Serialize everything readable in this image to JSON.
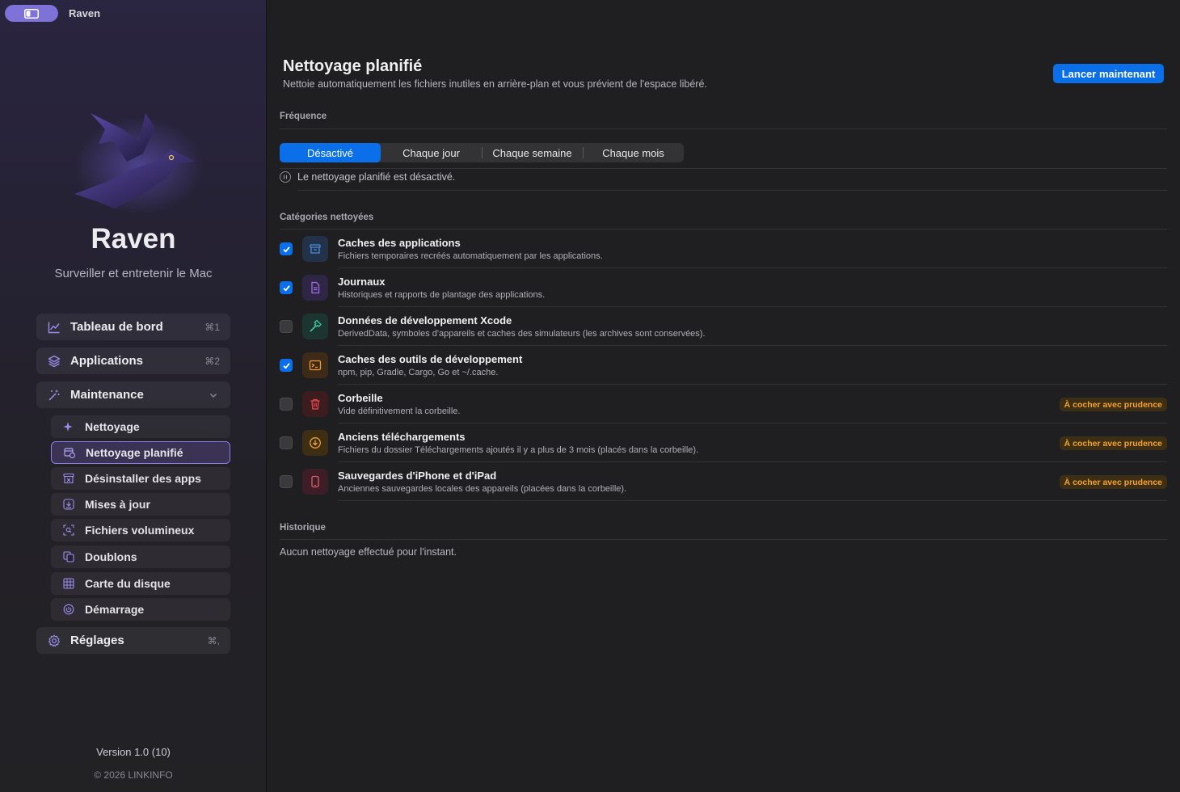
{
  "window": {
    "title": "Raven"
  },
  "brand": {
    "name": "Raven",
    "tagline": "Surveiller et entretenir le Mac"
  },
  "nav": {
    "dashboard": {
      "label": "Tableau de bord",
      "shortcut": "⌘1",
      "icon": "chart-line-icon"
    },
    "applications": {
      "label": "Applications",
      "shortcut": "⌘2",
      "icon": "layers-icon"
    },
    "maintenance": {
      "label": "Maintenance",
      "icon": "wand-icon"
    },
    "sub": [
      {
        "label": "Nettoyage",
        "icon": "sparkle-icon"
      },
      {
        "label": "Nettoyage planifié",
        "icon": "calendar-clock-icon",
        "active": true
      },
      {
        "label": "Désinstaller des apps",
        "icon": "uninstall-box-icon"
      },
      {
        "label": "Mises à jour",
        "icon": "download-icon"
      },
      {
        "label": "Fichiers volumineux",
        "icon": "scan-file-icon"
      },
      {
        "label": "Doublons",
        "icon": "duplicate-icon"
      },
      {
        "label": "Carte du disque",
        "icon": "grid-icon"
      },
      {
        "label": "Démarrage",
        "icon": "power-icon"
      }
    ],
    "settings": {
      "label": "Réglages",
      "shortcut": "⌘,",
      "icon": "gear-icon"
    }
  },
  "footer": {
    "version": "Version 1.0 (10)",
    "copyright": "© 2026 LINKINFO"
  },
  "page": {
    "title": "Nettoyage planifié",
    "subtitle": "Nettoie automatiquement les fichiers inutiles en arrière-plan et vous prévient de l'espace libéré.",
    "run_button": "Lancer maintenant"
  },
  "frequency": {
    "label": "Fréquence",
    "options": [
      "Désactivé",
      "Chaque jour",
      "Chaque semaine",
      "Chaque mois"
    ],
    "selected": "Désactivé",
    "status": "Le nettoyage planifié est désactivé."
  },
  "categories": {
    "label": "Catégories nettoyées",
    "caution_label": "À cocher avec prudence",
    "items": [
      {
        "title": "Caches des applications",
        "desc": "Fichiers temporaires recréés automatiquement par les applications.",
        "checked": true,
        "icon": "archive-box-icon",
        "color": "#4a90e2"
      },
      {
        "title": "Journaux",
        "desc": "Historiques et rapports de plantage des applications.",
        "checked": true,
        "icon": "document-icon",
        "color": "#a66be8"
      },
      {
        "title": "Données de développement Xcode",
        "desc": "DerivedData, symboles d'appareils et caches des simulateurs (les archives sont conservées).",
        "checked": false,
        "icon": "hammer-icon",
        "color": "#3ec7a0"
      },
      {
        "title": "Caches des outils de développement",
        "desc": "npm, pip, Gradle, Cargo, Go et ~/.cache.",
        "checked": true,
        "icon": "terminal-icon",
        "color": "#f29a3a"
      },
      {
        "title": "Corbeille",
        "desc": "Vide définitivement la corbeille.",
        "checked": false,
        "icon": "trash-icon",
        "color": "#e8464a",
        "caution": true
      },
      {
        "title": "Anciens téléchargements",
        "desc": "Fichiers du dossier Téléchargements ajoutés il y a plus de 3 mois (placés dans la corbeille).",
        "checked": false,
        "icon": "download-circle-icon",
        "color": "#f2a233",
        "caution": true
      },
      {
        "title": "Sauvegardes d'iPhone et d'iPad",
        "desc": "Anciennes sauvegardes locales des appareils (placées dans la corbeille).",
        "checked": false,
        "icon": "phone-icon",
        "color": "#e85a6a",
        "caution": true
      }
    ]
  },
  "history": {
    "label": "Historique",
    "empty": "Aucun nettoyage effectué pour l'instant."
  },
  "colors": {
    "accent": "#0a6fe8",
    "sidebar_accent": "#8a7fe0",
    "caution": "#f2a233"
  }
}
